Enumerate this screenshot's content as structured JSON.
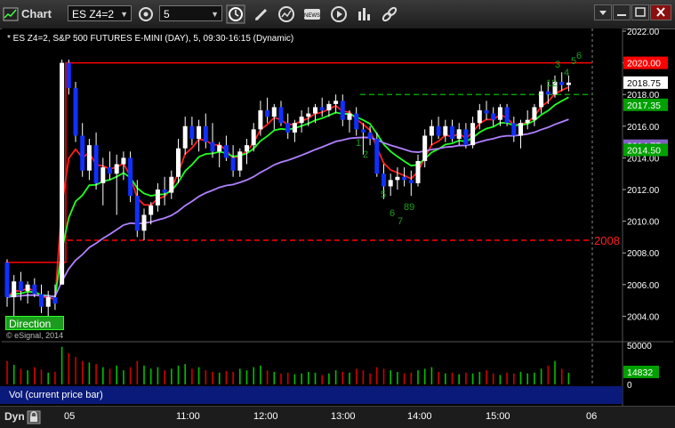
{
  "window": {
    "title": "Chart",
    "symbol": "ES Z4=2",
    "interval": "5"
  },
  "legend": {
    "text": "* ES Z4=2, S&P 500 FUTURES E-MINI (DAY), 5, 09:30-16:15 (Dynamic)"
  },
  "price_axis": {
    "ticks": [
      "2022.00",
      "2020.00",
      "2018.00",
      "2016.00",
      "2014.00",
      "2012.00",
      "2010.00",
      "2008.00",
      "2006.00",
      "2004.00"
    ],
    "badges": [
      {
        "text": "2020.00",
        "bg": "#ff0000",
        "fg": "#ffffff"
      },
      {
        "text": "2018.75",
        "bg": "#ffffff",
        "fg": "#000000"
      },
      {
        "text": "2017.35",
        "bg": "#00a000",
        "fg": "#ffffff"
      },
      {
        "text": "2014.77",
        "bg": "#8060c0",
        "fg": "#ffffff"
      },
      {
        "text": "2014.50",
        "bg": "#00a000",
        "fg": "#ffffff"
      }
    ],
    "level_label": "2008"
  },
  "annotations": [
    "1",
    "2",
    "5",
    "6",
    "7",
    "89",
    "12",
    "3",
    "4",
    "5",
    "6"
  ],
  "direction_button": "Direction",
  "watermark": "© eSignal, 2014",
  "volume": {
    "label": "Vol (current price bar)",
    "ticks": [
      "50000",
      "0"
    ],
    "badge": "14832"
  },
  "time_axis": {
    "mode": "Dyn",
    "labels": [
      "05",
      "11:00",
      "12:00",
      "13:00",
      "14:00",
      "15:00",
      "06"
    ]
  },
  "colors": {
    "up_candle": "#ffffff",
    "down_candle": "#1030ff",
    "resistance": "#ff0000",
    "ma_red": "#ff2020",
    "ma_green": "#20ff20",
    "ma_purple": "#b080ff",
    "volume_up": "#00c000",
    "volume_down": "#d00000"
  },
  "chart_data": {
    "type": "candlestick",
    "symbol": "ES Z4=2",
    "ylim": [
      2003,
      2022.5
    ],
    "horizontal_lines": [
      {
        "value": 2020.0,
        "style": "solid",
        "color": "#ff0000"
      },
      {
        "value": 2008.8,
        "style": "dashed",
        "color": "#ff0000",
        "label": "2008"
      },
      {
        "value": 2018.0,
        "style": "dashed",
        "color": "#00a000"
      }
    ],
    "candles": [
      [
        2007.4,
        2007.6,
        2004.6,
        2005.2
      ],
      [
        2005.2,
        2006.6,
        2004.0,
        2006.2
      ],
      [
        2006.2,
        2006.8,
        2005.0,
        2005.6
      ],
      [
        2005.6,
        2006.2,
        2004.8,
        2006.0
      ],
      [
        2006.0,
        2006.4,
        2005.2,
        2005.4
      ],
      [
        2005.4,
        2006.0,
        2004.2,
        2004.6
      ],
      [
        2004.6,
        2005.6,
        2003.8,
        2005.2
      ],
      [
        2005.2,
        2006.0,
        2004.4,
        2004.8
      ],
      [
        2006.0,
        2020.2,
        2006.0,
        2020.0
      ],
      [
        2020.0,
        2020.2,
        2018.0,
        2018.4
      ],
      [
        2018.4,
        2018.8,
        2015.0,
        2015.4
      ],
      [
        2015.4,
        2016.2,
        2012.8,
        2013.2
      ],
      [
        2013.2,
        2015.2,
        2012.6,
        2014.8
      ],
      [
        2014.8,
        2015.6,
        2012.0,
        2012.4
      ],
      [
        2012.4,
        2014.0,
        2011.0,
        2013.4
      ],
      [
        2013.4,
        2014.4,
        2012.6,
        2013.0
      ],
      [
        2013.0,
        2014.2,
        2010.4,
        2013.6
      ],
      [
        2013.6,
        2014.4,
        2012.6,
        2014.0
      ],
      [
        2014.0,
        2014.4,
        2011.2,
        2011.6
      ],
      [
        2011.6,
        2012.6,
        2009.0,
        2009.4
      ],
      [
        2009.4,
        2010.8,
        2008.8,
        2010.4
      ],
      [
        2010.4,
        2011.2,
        2009.8,
        2011.0
      ],
      [
        2011.0,
        2012.4,
        2010.6,
        2012.0
      ],
      [
        2012.0,
        2012.8,
        2011.0,
        2011.8
      ],
      [
        2011.8,
        2013.2,
        2011.4,
        2012.8
      ],
      [
        2012.8,
        2015.2,
        2012.4,
        2014.6
      ],
      [
        2014.6,
        2016.6,
        2014.2,
        2016.0
      ],
      [
        2016.0,
        2016.6,
        2014.8,
        2015.2
      ],
      [
        2015.2,
        2016.4,
        2014.4,
        2016.0
      ],
      [
        2016.0,
        2016.8,
        2014.6,
        2015.0
      ],
      [
        2015.0,
        2016.2,
        2014.0,
        2014.4
      ],
      [
        2014.4,
        2015.0,
        2013.4,
        2014.8
      ],
      [
        2014.8,
        2015.4,
        2013.8,
        2014.0
      ],
      [
        2014.0,
        2014.8,
        2012.8,
        2013.2
      ],
      [
        2013.2,
        2014.6,
        2012.8,
        2014.4
      ],
      [
        2014.4,
        2015.2,
        2013.6,
        2014.8
      ],
      [
        2014.8,
        2016.2,
        2014.4,
        2015.8
      ],
      [
        2015.8,
        2017.6,
        2015.4,
        2017.0
      ],
      [
        2017.0,
        2017.8,
        2016.2,
        2016.6
      ],
      [
        2016.6,
        2017.4,
        2015.8,
        2017.2
      ],
      [
        2017.2,
        2017.6,
        2016.0,
        2016.2
      ],
      [
        2016.2,
        2016.8,
        2015.2,
        2015.6
      ],
      [
        2015.6,
        2016.4,
        2015.0,
        2016.2
      ],
      [
        2016.2,
        2017.0,
        2015.6,
        2016.6
      ],
      [
        2016.6,
        2017.2,
        2016.0,
        2016.8
      ],
      [
        2016.8,
        2017.4,
        2016.2,
        2017.2
      ],
      [
        2017.2,
        2017.8,
        2016.6,
        2017.0
      ],
      [
        2017.0,
        2017.6,
        2016.6,
        2017.4
      ],
      [
        2017.4,
        2018.0,
        2016.8,
        2017.6
      ],
      [
        2017.6,
        2018.0,
        2016.0,
        2016.4
      ],
      [
        2016.4,
        2017.0,
        2015.6,
        2016.8
      ],
      [
        2016.8,
        2017.2,
        2015.4,
        2015.8
      ],
      [
        2015.8,
        2016.2,
        2014.2,
        2015.6
      ],
      [
        2015.6,
        2016.0,
        2014.8,
        2015.2
      ],
      [
        2015.2,
        2015.6,
        2012.8,
        2013.0
      ],
      [
        2013.0,
        2013.6,
        2011.4,
        2012.2
      ],
      [
        2012.2,
        2013.0,
        2011.6,
        2012.6
      ],
      [
        2012.6,
        2013.4,
        2012.0,
        2012.8
      ],
      [
        2012.8,
        2013.4,
        2012.2,
        2012.6
      ],
      [
        2012.6,
        2013.2,
        2011.6,
        2012.4
      ],
      [
        2012.4,
        2014.2,
        2012.2,
        2013.8
      ],
      [
        2013.8,
        2015.8,
        2013.4,
        2015.4
      ],
      [
        2015.4,
        2016.4,
        2014.8,
        2016.0
      ],
      [
        2016.0,
        2016.6,
        2015.2,
        2015.4
      ],
      [
        2015.4,
        2016.4,
        2015.0,
        2016.0
      ],
      [
        2016.0,
        2016.4,
        2015.0,
        2015.2
      ],
      [
        2015.2,
        2016.2,
        2014.8,
        2015.8
      ],
      [
        2015.8,
        2016.2,
        2014.6,
        2014.8
      ],
      [
        2014.8,
        2016.6,
        2014.6,
        2016.2
      ],
      [
        2016.2,
        2017.4,
        2015.8,
        2017.0
      ],
      [
        2017.0,
        2017.6,
        2016.4,
        2016.8
      ],
      [
        2016.8,
        2017.2,
        2016.0,
        2016.4
      ],
      [
        2016.4,
        2017.4,
        2016.0,
        2017.2
      ],
      [
        2017.2,
        2017.4,
        2016.0,
        2016.2
      ],
      [
        2016.2,
        2016.6,
        2015.0,
        2015.4
      ],
      [
        2015.4,
        2016.4,
        2014.6,
        2016.2
      ],
      [
        2016.2,
        2017.0,
        2015.8,
        2016.4
      ],
      [
        2016.4,
        2017.4,
        2016.0,
        2017.2
      ],
      [
        2017.2,
        2018.6,
        2016.8,
        2018.2
      ],
      [
        2018.2,
        2018.8,
        2017.4,
        2018.0
      ],
      [
        2018.0,
        2019.2,
        2017.8,
        2018.8
      ],
      [
        2018.8,
        2019.4,
        2018.2,
        2018.6
      ],
      [
        2018.6,
        2019.2,
        2018.2,
        2018.75
      ]
    ],
    "volume": [
      30,
      25,
      20,
      18,
      22,
      19,
      15,
      16,
      48,
      40,
      35,
      30,
      28,
      26,
      22,
      20,
      24,
      18,
      22,
      30,
      24,
      20,
      22,
      18,
      20,
      24,
      26,
      20,
      22,
      18,
      16,
      15,
      17,
      16,
      20,
      18,
      22,
      24,
      18,
      16,
      14,
      15,
      13,
      14,
      16,
      15,
      12,
      14,
      18,
      16,
      15,
      20,
      18,
      14,
      22,
      20,
      18,
      16,
      14,
      15,
      18,
      20,
      22,
      16,
      14,
      15,
      13,
      15,
      14,
      16,
      18,
      14,
      12,
      15,
      14,
      16,
      14,
      15,
      20,
      24,
      30,
      20,
      14.832
    ]
  }
}
